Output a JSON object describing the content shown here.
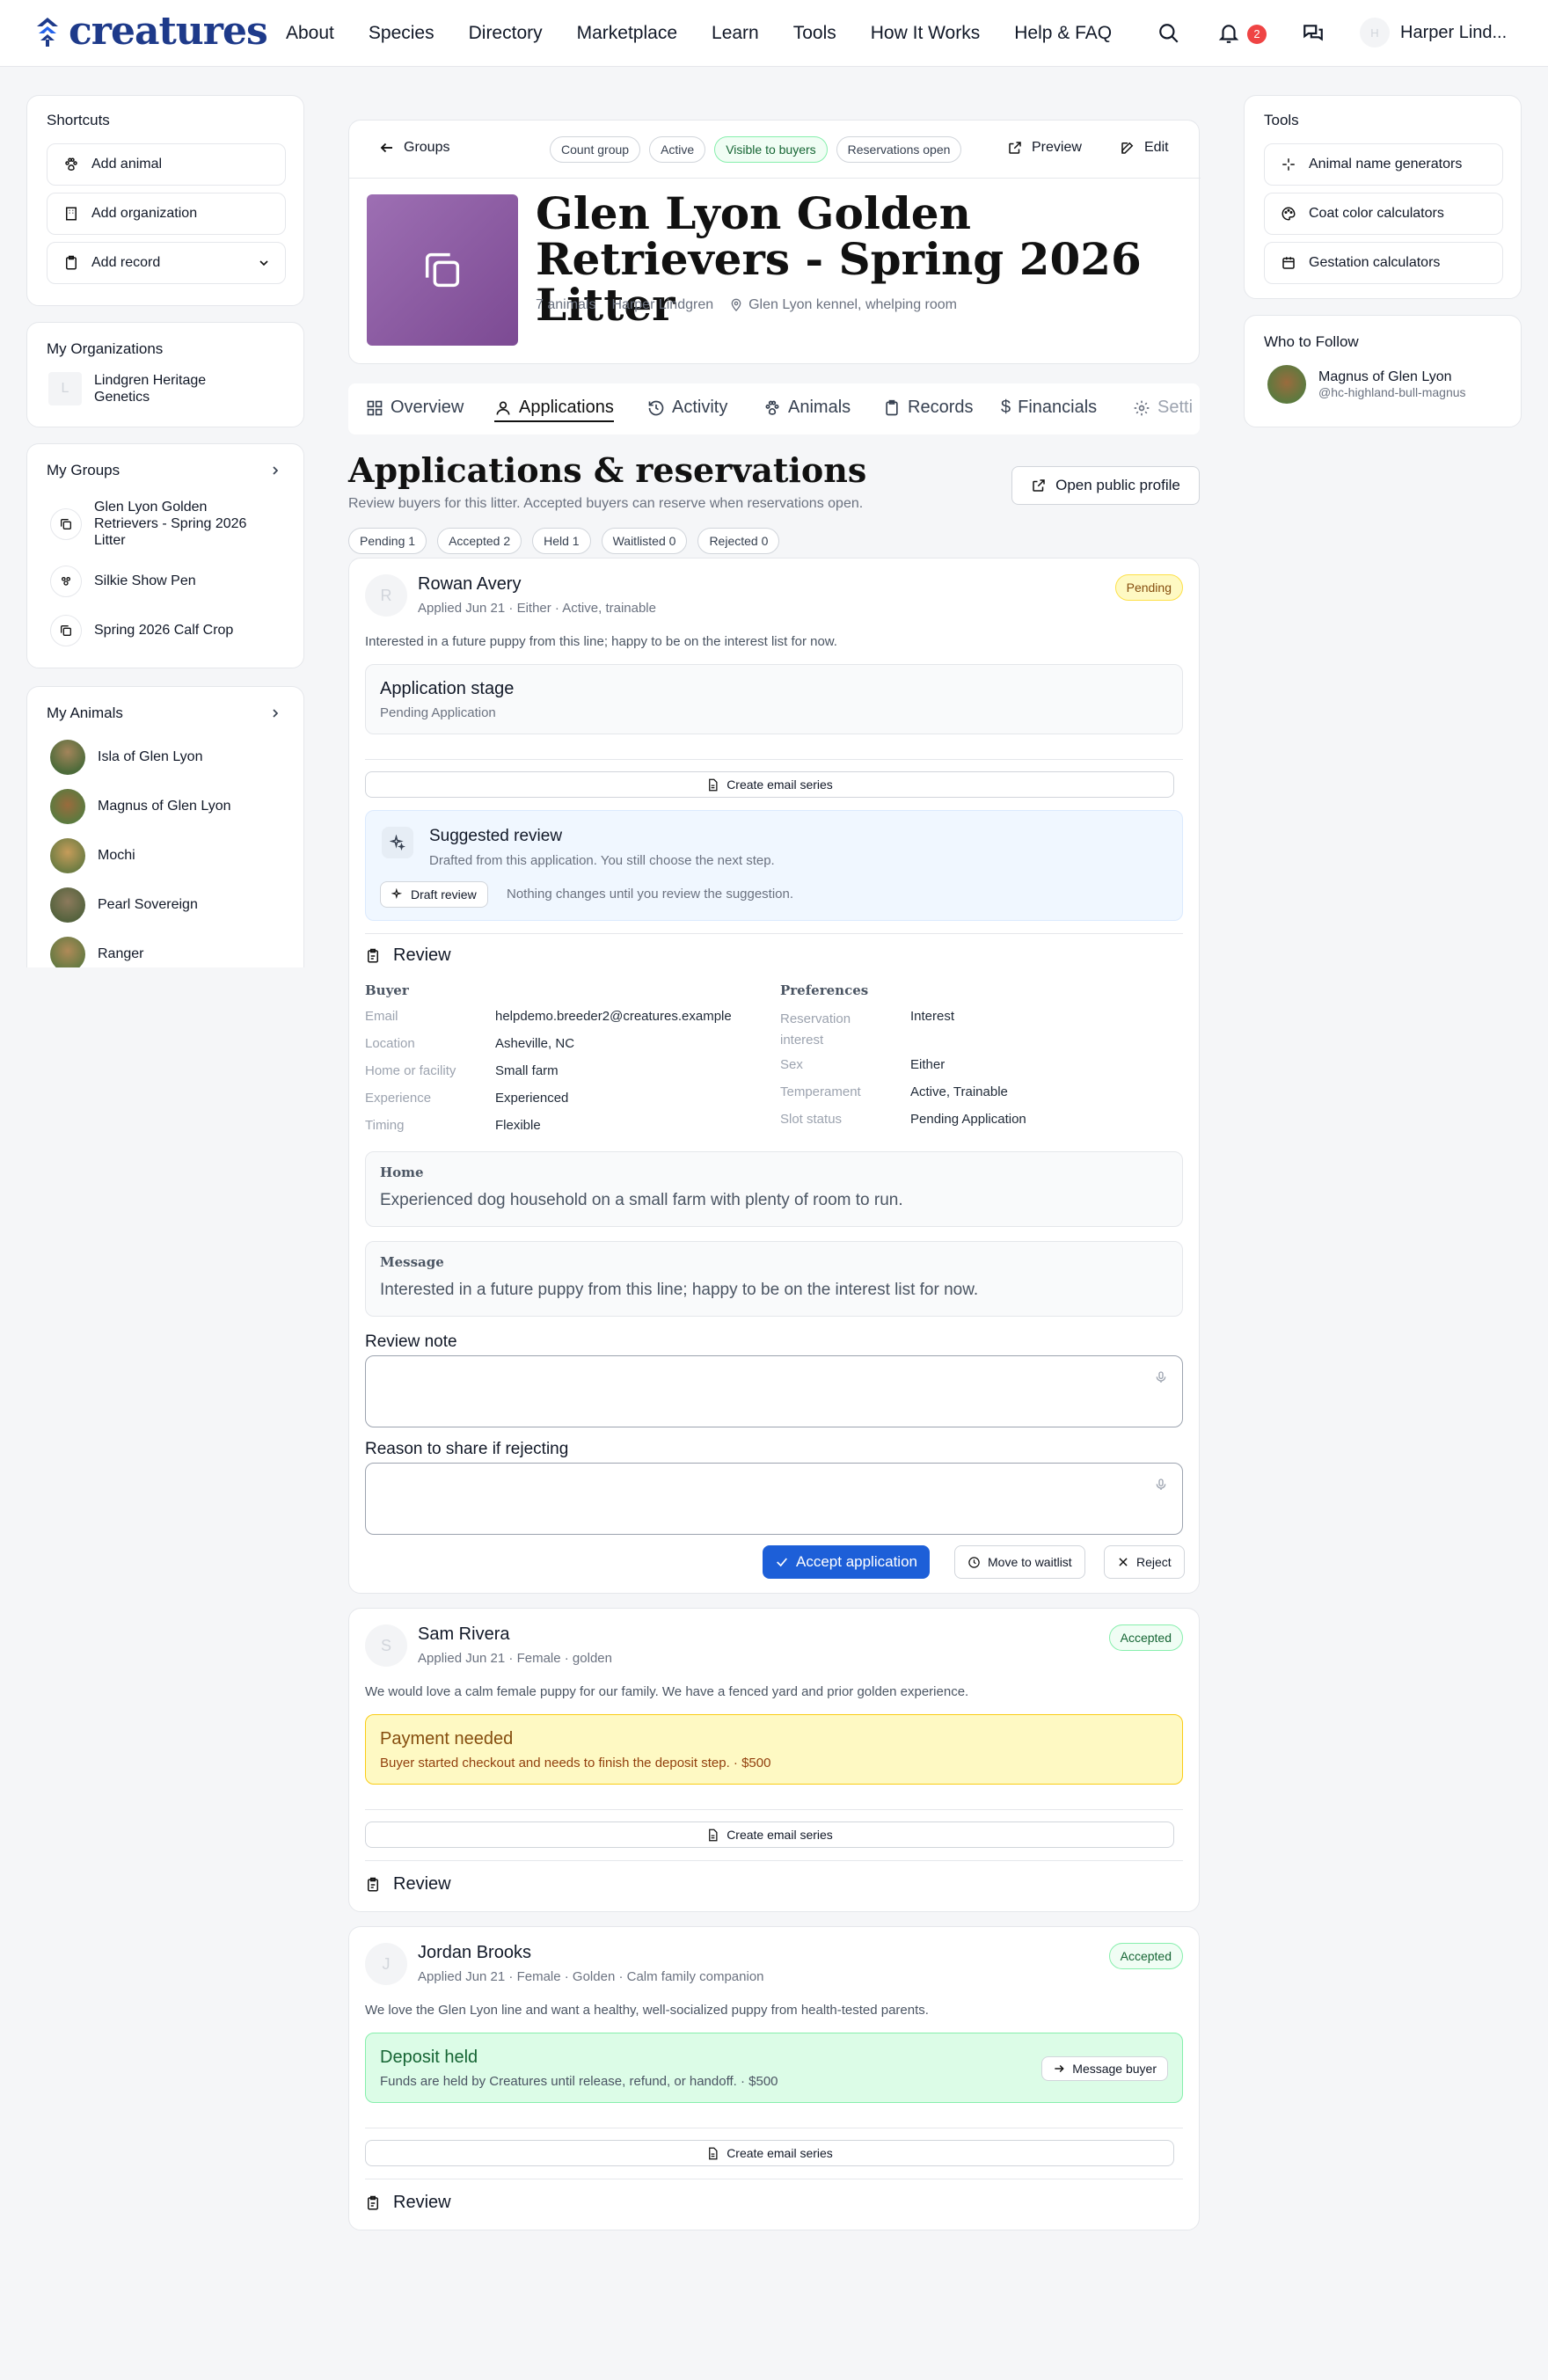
{
  "brand": {
    "name": "creatures",
    "color": "#1e3a8a"
  },
  "nav": [
    "About",
    "Species",
    "Directory",
    "Marketplace",
    "Learn",
    "Tools",
    "How It Works",
    "Help & FAQ"
  ],
  "header": {
    "notifications": "2",
    "user_initial": "H",
    "user_name": "Harper Lind..."
  },
  "shortcuts": {
    "title": "Shortcuts",
    "items": [
      "Add animal",
      "Add organization",
      "Add record"
    ]
  },
  "orgs": {
    "title": "My Organizations",
    "items": [
      {
        "initial": "L",
        "name": "Lindgren Heritage Genetics"
      }
    ]
  },
  "groups": {
    "title": "My Groups",
    "items": [
      "Glen Lyon Golden Retrievers - Spring 2026 Litter",
      "Silkie Show Pen",
      "Spring 2026 Calf Crop"
    ]
  },
  "animals": {
    "title": "My Animals",
    "items": [
      "Isla of Glen Lyon",
      "Magnus of Glen Lyon",
      "Mochi",
      "Pearl Sovereign",
      "Ranger"
    ]
  },
  "tools": {
    "title": "Tools",
    "items": [
      "Animal name generators",
      "Coat color calculators",
      "Gestation calculators"
    ]
  },
  "follow": {
    "title": "Who to Follow",
    "name": "Magnus of Glen Lyon",
    "handle": "@hc-highland-bull-magnus"
  },
  "group": {
    "back": "Groups",
    "pills": [
      "Count group",
      "Active",
      "Visible to buyers",
      "Reservations open"
    ],
    "preview": "Preview",
    "edit": "Edit",
    "title": "Glen Lyon Golden Retrievers - Spring 2026 Litter",
    "animals": "7 animals",
    "owner": "Harper Lindgren",
    "location": "Glen Lyon kennel, whelping room",
    "accent": "#8b5a9e"
  },
  "tabs": [
    "Overview",
    "Applications",
    "Activity",
    "Animals",
    "Records",
    "Financials",
    "Setti"
  ],
  "section": {
    "title": "Applications & reservations",
    "subtitle": "Review buyers for this litter. Accepted buyers can reserve when reservations open.",
    "open_profile": "Open public profile",
    "filters": [
      "Pending 1",
      "Accepted 2",
      "Held 1",
      "Waitlisted 0",
      "Rejected 0"
    ]
  },
  "applications": [
    {
      "initial": "R",
      "name": "Rowan Avery",
      "meta": "Applied Jun 21 · Either · Active, trainable",
      "status": "Pending",
      "message": "Interested in a future puppy from this line; happy to be on the interest list for now.",
      "stage_title": "Application stage",
      "stage_sub": "Pending Application",
      "email_series": "Create email series",
      "suggest_title": "Suggested review",
      "suggest_sub": "Drafted from this application. You still choose the next step.",
      "draft_btn": "Draft review",
      "draft_note": "Nothing changes until you review the suggestion.",
      "review": "Review",
      "buyer_h": "Buyer",
      "prefs_h": "Preferences",
      "buyer": [
        [
          "Email",
          "helpdemo.breeder2@creatures.example"
        ],
        [
          "Location",
          "Asheville, NC"
        ],
        [
          "Home or facility",
          "Small farm"
        ],
        [
          "Experience",
          "Experienced"
        ],
        [
          "Timing",
          "Flexible"
        ]
      ],
      "prefs": [
        [
          "Reservation interest",
          "Interest"
        ],
        [
          "Sex",
          "Either"
        ],
        [
          "Temperament",
          "Active, Trainable"
        ],
        [
          "Slot status",
          "Pending Application"
        ]
      ],
      "home_h": "Home",
      "home": "Experienced dog household on a small farm with plenty of room to run.",
      "msg_h": "Message",
      "msg": "Interested in a future puppy from this line; happy to be on the interest list for now.",
      "note_label": "Review note",
      "reject_label": "Reason to share if rejecting",
      "accept": "Accept application",
      "waitlist": "Move to waitlist",
      "reject": "Reject"
    },
    {
      "initial": "S",
      "name": "Sam Rivera",
      "meta": "Applied Jun 21 · Female · golden",
      "status": "Accepted",
      "message": "We would love a calm female puppy for our family. We have a fenced yard and prior golden experience.",
      "box_title": "Payment needed",
      "box_sub": "Buyer started checkout and needs to finish the deposit step. · $500",
      "email_series": "Create email series",
      "review": "Review"
    },
    {
      "initial": "J",
      "name": "Jordan Brooks",
      "meta": "Applied Jun 21 · Female · Golden · Calm family companion",
      "status": "Accepted",
      "message": "We love the Glen Lyon line and want a healthy, well-socialized puppy from health-tested parents.",
      "box_title": "Deposit held",
      "box_sub": "Funds are held by Creatures until release, refund, or handoff. · $500",
      "msg_btn": "Message buyer",
      "email_series": "Create email series",
      "review": "Review"
    }
  ]
}
